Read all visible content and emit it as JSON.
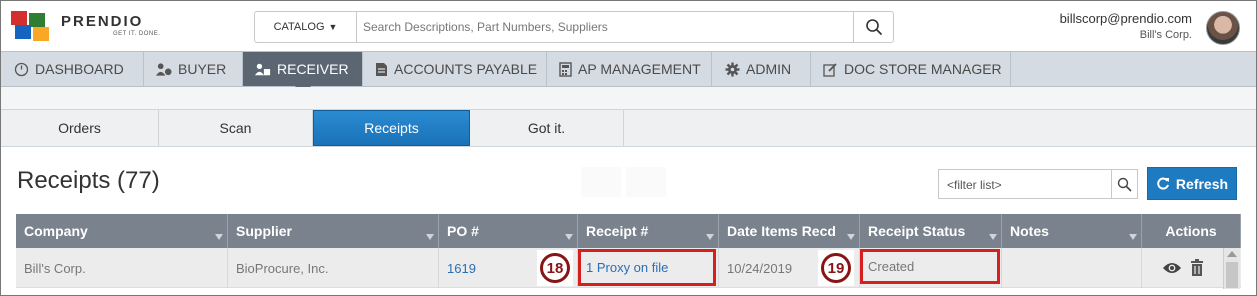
{
  "brand": {
    "name": "PRENDIO",
    "tagline": "GET IT. DONE."
  },
  "search": {
    "catalog_label": "CATALOG",
    "placeholder": "Search Descriptions, Part Numbers, Suppliers"
  },
  "user": {
    "email": "billscorp@prendio.com",
    "company": "Bill's Corp."
  },
  "main_nav": [
    {
      "label": "DASHBOARD",
      "icon": "dashboard-icon"
    },
    {
      "label": "BUYER",
      "icon": "buyer-icon"
    },
    {
      "label": "RECEIVER",
      "icon": "receiver-icon",
      "active": true
    },
    {
      "label": "ACCOUNTS PAYABLE",
      "icon": "document-icon"
    },
    {
      "label": "AP MANAGEMENT",
      "icon": "calculator-icon"
    },
    {
      "label": "ADMIN",
      "icon": "gear-icon"
    },
    {
      "label": "DOC STORE MANAGER",
      "icon": "edit-icon"
    }
  ],
  "sub_tabs": [
    {
      "label": "Orders"
    },
    {
      "label": "Scan"
    },
    {
      "label": "Receipts",
      "active": true
    },
    {
      "label": "Got it."
    }
  ],
  "page": {
    "title": "Receipts (77)"
  },
  "filter": {
    "placeholder": "<filter list>"
  },
  "refresh_label": "Refresh",
  "table": {
    "columns": [
      "Company",
      "Supplier",
      "PO #",
      "Receipt #",
      "Date Items Recd",
      "Receipt Status",
      "Notes",
      "Actions"
    ],
    "rows": [
      {
        "company": "Bill's Corp.",
        "supplier": "BioProcure, Inc.",
        "po": "1619",
        "receipt": "1 Proxy on file",
        "date": "10/24/2019",
        "status": "Created",
        "notes": ""
      }
    ]
  },
  "callouts": {
    "receipt": "18",
    "status": "19"
  },
  "colors": {
    "accent": "#1f7bc1",
    "nav_active": "#5c6673",
    "highlight": "#d61f1f"
  }
}
